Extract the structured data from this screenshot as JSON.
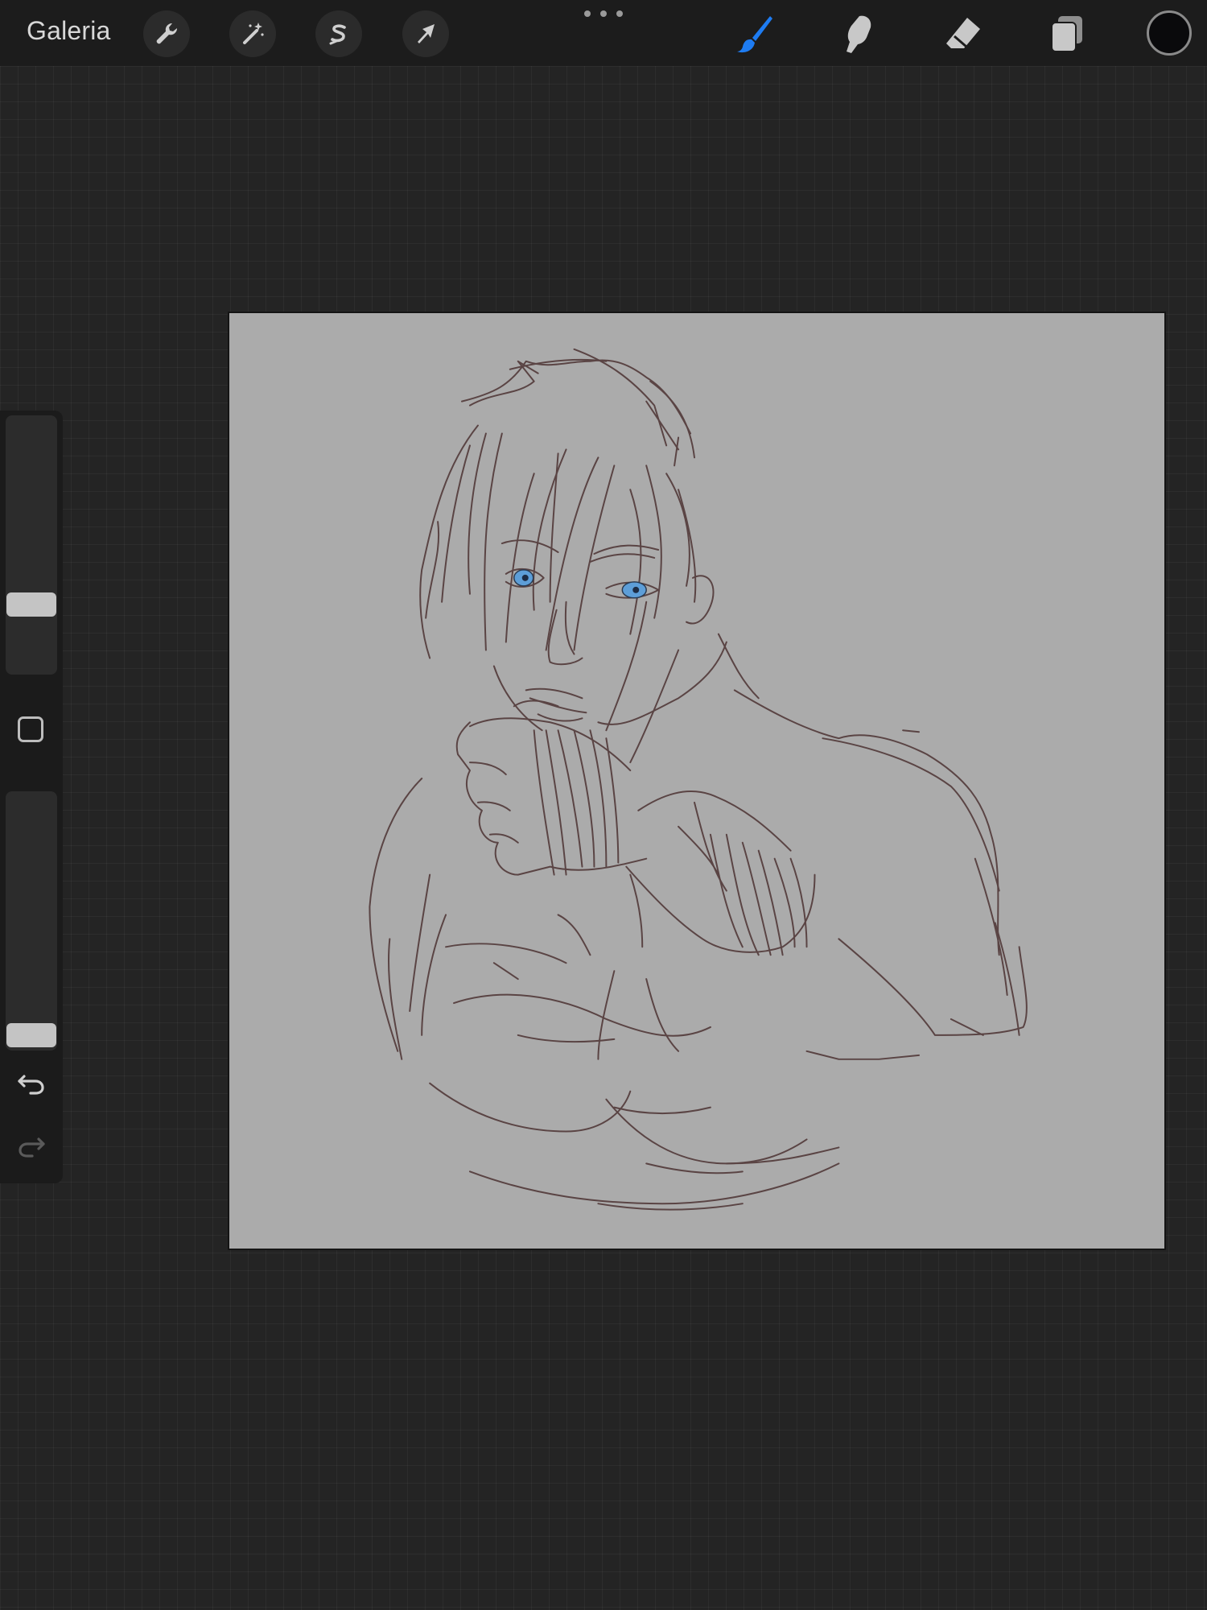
{
  "topbar": {
    "gallery_label": "Galeria",
    "actions": [
      {
        "name": "actions-wrench",
        "icon": "wrench-icon"
      },
      {
        "name": "adjustments-wand",
        "icon": "magic-wand-icon"
      },
      {
        "name": "selection",
        "icon": "selection-s-icon"
      },
      {
        "name": "transform",
        "icon": "arrow-cursor-icon"
      }
    ],
    "menu_icon": "more-dots-icon",
    "paint_tools": [
      {
        "name": "brush",
        "icon": "brush-icon",
        "active": true,
        "color": "#1e7cf2"
      },
      {
        "name": "smudge",
        "icon": "smudge-finger-icon",
        "active": false,
        "color": "#c8c8c8"
      },
      {
        "name": "eraser",
        "icon": "eraser-icon",
        "active": false,
        "color": "#c8c8c8"
      },
      {
        "name": "layers",
        "icon": "layers-icon",
        "active": false,
        "color": "#c8c8c8"
      }
    ],
    "current_color": "#0a0a0c"
  },
  "sidebar": {
    "brush_size_fraction": 0.24,
    "opacity_fraction": 0.0,
    "modify_icon": "square-modify-icon",
    "undo_icon": "undo-icon",
    "redo_icon": "redo-icon",
    "redo_enabled": false
  },
  "canvas": {
    "background": "#ababab",
    "stroke_color": "#5a4444",
    "eye_color": "#5d9ed8"
  }
}
